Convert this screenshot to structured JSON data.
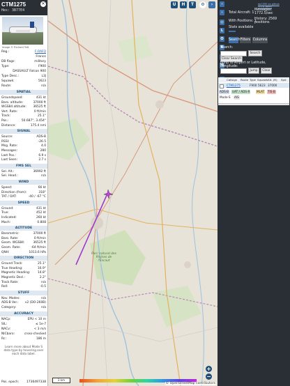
{
  "aircraft": {
    "callsign": "CTM1275",
    "hex_line": "Hex: 3B77E4",
    "photo_credit": "Image © Richard Toft",
    "fields_top": [
      {
        "k": "Reg.:",
        "v": "F-RAFQ",
        "link": true
      },
      {
        "k": "",
        "v": "France",
        "link": false
      },
      {
        "k": "DB flags:",
        "v": "military",
        "link": false
      },
      {
        "k": "Type:",
        "v": "F900",
        "link": false
      },
      {
        "k": "",
        "v": "DASSAULT Falcon 900",
        "link": false
      },
      {
        "k": "Type Desc.:",
        "v": "L3J",
        "link": false
      },
      {
        "k": "Squawk:",
        "v": "5623",
        "link": false
      },
      {
        "k": "Route:",
        "v": "n/a",
        "link": false
      }
    ]
  },
  "sections": {
    "spatial": "SPATIAL",
    "signal": "SIGNAL",
    "fms": "FMS SEL",
    "wind": "WIND",
    "speed": "SPEED",
    "altitude": "ALTITUDE",
    "direction": "DIRECTION",
    "stuff": "STUFF",
    "accuracy": "ACCURACY"
  },
  "spatial": [
    {
      "k": "Groundspeed:",
      "v": "431 kt"
    },
    {
      "k": "Baro. altitude:",
      "v": "37000 ft"
    },
    {
      "k": "WGS84 altitude:",
      "v": "36525 ft"
    },
    {
      "k": "Vert. Rate:",
      "v": "0 ft/min"
    },
    {
      "k": "Track:",
      "v": "25.1°"
    },
    {
      "k": "Pos.:",
      "v": "50.687°, 3.454°"
    },
    {
      "k": "Distance:",
      "v": "175.4 nmi"
    }
  ],
  "signal": [
    {
      "k": "Source:",
      "v": "ADS-B"
    },
    {
      "k": "RSSI:",
      "v": "-26.5"
    },
    {
      "k": "Msg. Rate:",
      "v": "4.0"
    },
    {
      "k": "Messages:",
      "v": "280"
    },
    {
      "k": "Last Pos.:",
      "v": "6.9 s"
    },
    {
      "k": "Last Seen:",
      "v": "2.7 s"
    }
  ],
  "fms": [
    {
      "k": "Sel. Alt.:",
      "v": "36992 ft"
    },
    {
      "k": "Sel. Head.:",
      "v": "n/a"
    }
  ],
  "wind": [
    {
      "k": "Speed:",
      "v": "66 kt"
    },
    {
      "k": "Direction (from):",
      "v": "318°"
    },
    {
      "k": "TAT / OAT:",
      "v": "-40 / -67 °C"
    }
  ],
  "speed": [
    {
      "k": "Ground:",
      "v": "431 kt"
    },
    {
      "k": "True:",
      "v": "452 kt"
    },
    {
      "k": "Indicated:",
      "v": "260 kt"
    },
    {
      "k": "Mach:",
      "v": "0.808"
    }
  ],
  "altitude": [
    {
      "k": "Barometric:",
      "v": "37000 ft"
    },
    {
      "k": "Baro. Rate:",
      "v": "0 ft/min"
    },
    {
      "k": "Geom. WGS84:",
      "v": "36525 ft"
    },
    {
      "k": "Geom. Rate:",
      "v": "-64 ft/min"
    },
    {
      "k": "QNH:",
      "v": "1013.6 hPa"
    }
  ],
  "direction": [
    {
      "k": "Ground Track:",
      "v": "25.1°"
    },
    {
      "k": "True Heading:",
      "v": "16.9°"
    },
    {
      "k": "Magnetic Heading:",
      "v": "14.8°"
    },
    {
      "k": "Magnetic Decl.:",
      "v": "2.2°"
    },
    {
      "k": "Track Rate:",
      "v": "n/a"
    },
    {
      "k": "Roll:",
      "v": "-0.5"
    }
  ],
  "stuff": [
    {
      "k": "Nav. Modes:",
      "v": "n/a"
    },
    {
      "k": "ADS-B Ver.:",
      "v": "v2 (DO-260B)"
    },
    {
      "k": "Category:",
      "v": "n/a"
    }
  ],
  "accuracy": [
    {
      "k": "NACp:",
      "v": "EPU < 10 m"
    },
    {
      "k": "SIL:",
      "v": "≤ 1e-7"
    },
    {
      "k": "NACv:",
      "v": "< 3 m/s"
    },
    {
      "k": "NICbaro:",
      "v": "cross-checked"
    },
    {
      "k": "Rc:",
      "v": "186 m"
    }
  ],
  "footer": {
    "note": "Learn more about Mode S data type by hovering over each data label.",
    "pos_epoch_k": "Pos. epoch:",
    "pos_epoch_v": "1736497338"
  },
  "map": {
    "buttons_top": [
      "U",
      "H",
      "T"
    ],
    "side_buttons": [
      "L",
      "O",
      "K",
      "V",
      "M",
      "P",
      "I",
      "R"
    ],
    "place_label": "Parc naturel des Plaines de l'Escaut",
    "osm": "© OpenStreetMap contributors",
    "scale": "2 km",
    "zoom_in": "+",
    "zoom_out": "−"
  },
  "right": {
    "link": "tar1090 on github (3.14.1695)",
    "total_aircraft": "Total Aircraft: 1",
    "with_positions": "With Positions: 1",
    "messages": "Messages: 1772.5/sec",
    "history": "History: 2569 positions",
    "stats": "Stats available",
    "tabs": [
      "Search",
      "Filters",
      "Columns"
    ],
    "search_label": "Search:",
    "search_btn": "Search",
    "clear_search": "Clear Search",
    "jump_label": "Jump to Airport or Latitude, Longitude:",
    "jump_btn": "Jump",
    "clear_btn": "Clear",
    "columns": [
      "Callsign",
      "Route",
      "Type",
      "Squawk",
      "Alt. (ft)",
      "Spd"
    ],
    "row": {
      "callsign": "CTM1275",
      "type": "F900",
      "squawk": "5623",
      "alt": "37000"
    },
    "tags": [
      "ADS-B",
      "UAT / ADS-R",
      "MLAT",
      "TIS-B",
      "Mode-S",
      "AIS"
    ]
  }
}
